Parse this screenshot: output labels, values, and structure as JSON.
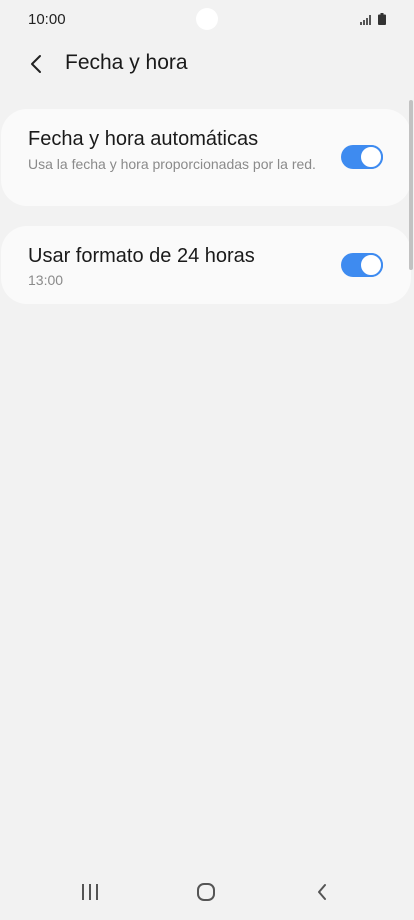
{
  "status_bar": {
    "time": "10:00",
    "icons": [
      "signal-icon",
      "battery-icon"
    ]
  },
  "header": {
    "back_icon": "chevron-left-icon",
    "title": "Fecha y hora"
  },
  "settings": [
    {
      "title": "Fecha y hora automáticas",
      "subtitle": "Usa la fecha y hora proporcionadas por la red.",
      "enabled": true
    },
    {
      "title": "Usar formato de 24 horas",
      "subtitle": "13:00",
      "enabled": true
    }
  ],
  "nav_bar": {
    "icons": [
      "recents-icon",
      "home-icon",
      "back-icon"
    ]
  },
  "colors": {
    "accent": "#3e8bf0",
    "background": "#f2f2f2",
    "card": "#fafafa"
  }
}
